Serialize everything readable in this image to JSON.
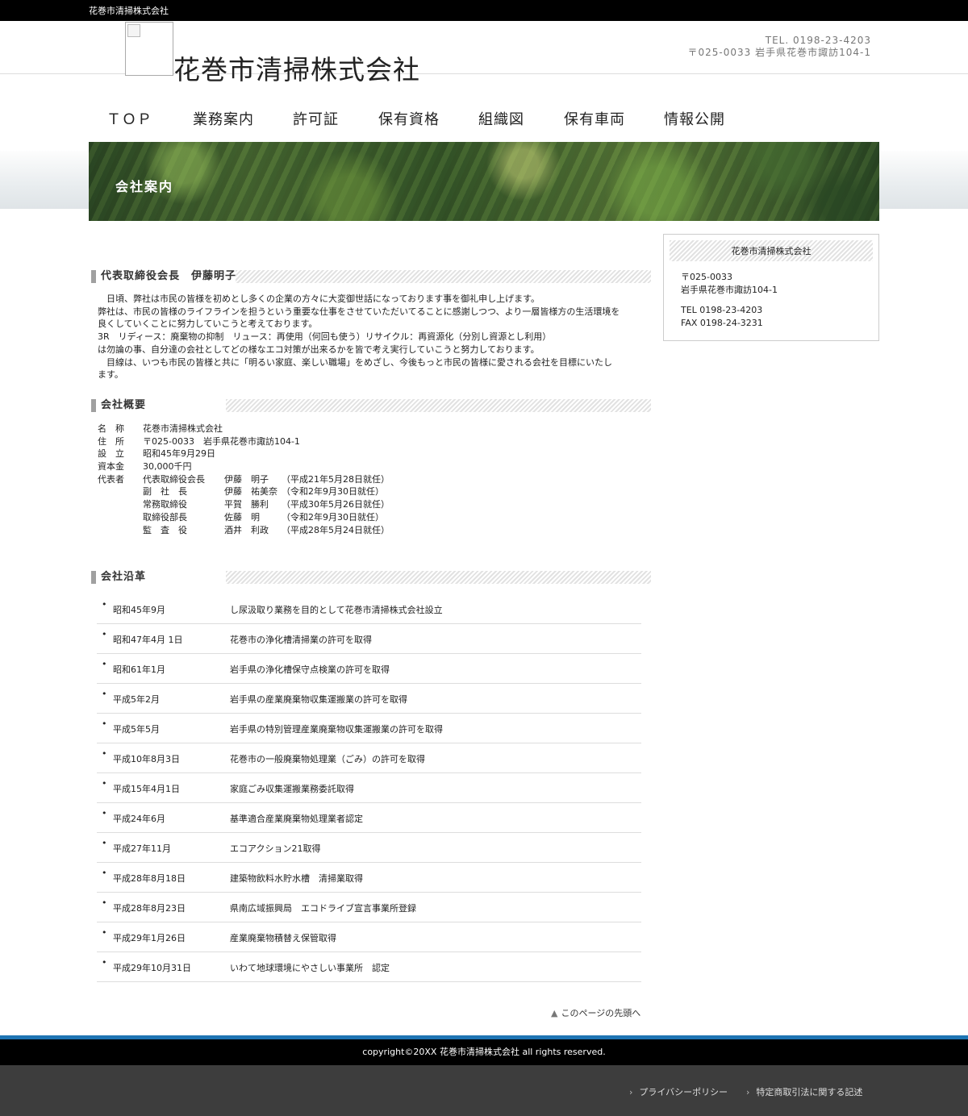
{
  "topbar": {
    "text": "花巻市清掃株式会社"
  },
  "header": {
    "site_name": "花巻市清掃株式会社",
    "tel": "TEL. 0198-23-4203",
    "address": "〒025-0033 岩手県花巻市諏訪104-1"
  },
  "nav": {
    "items": [
      {
        "label": "ＴＯＰ"
      },
      {
        "label": "業務案内"
      },
      {
        "label": "許可証"
      },
      {
        "label": "保有資格"
      },
      {
        "label": "組織図"
      },
      {
        "label": "保有車両"
      },
      {
        "label": "情報公開"
      }
    ]
  },
  "hero": {
    "title": "会社案内"
  },
  "greeting": {
    "heading": "代表取締役会長　伊藤明子",
    "lines": [
      "　日頃、弊社は市民の皆様を初めとし多くの企業の方々に大変御世話になっております事を御礼申し上げます。",
      "弊社は、市民の皆様のライフラインを担うという重要な仕事をさせていただいてることに感謝しつつ、より一層皆様方の生活環境を",
      "良くしていくことに努力していこうと考えております。",
      "3R　リディース：廃棄物の抑制　リュース：再使用（何回も使う）リサイクル：再資源化（分別し資源とし利用）",
      "は勿論の事、自分達の会社としてどの様なエコ対策が出来るかを皆で考え実行していこうと努力しております。",
      "　目線は、いつも市民の皆様と共に「明るい家庭、楽しい職場」をめざし、今後もっと市民の皆様に愛される会社を目標にいたし",
      "ます。"
    ]
  },
  "overview": {
    "heading": "会社概要",
    "rows": [
      {
        "label": "名　称",
        "value": "花巻市清掃株式会社"
      },
      {
        "label": "住　所",
        "value": "〒025-0033　岩手県花巻市諏訪104-1"
      },
      {
        "label": "設　立",
        "value": "昭和45年9月29日"
      },
      {
        "label": "資本金",
        "value": "30,000千円"
      }
    ],
    "rep_label": "代表者",
    "officers": [
      {
        "title": "代表取締役会長",
        "name": "伊藤　明子",
        "note": "（平成21年5月28日就任）"
      },
      {
        "title": "副　社　長",
        "name": "伊藤　祐美奈",
        "note": "（令和2年9月30日就任）"
      },
      {
        "title": "常務取締役",
        "name": "平賀　勝利",
        "note": "（平成30年5月26日就任）"
      },
      {
        "title": "取締役部長",
        "name": "佐藤　明",
        "note": "（令和2年9月30日就任）"
      },
      {
        "title": "監　査　役",
        "name": "酒井　利政",
        "note": "（平成28年5月24日就任）"
      }
    ]
  },
  "history": {
    "heading": "会社沿革",
    "items": [
      {
        "date": "昭和45年9月",
        "event": "し尿汲取り業務を目的として花巻市清掃株式会社設立"
      },
      {
        "date": "昭和47年4月 1日",
        "event": "花巻市の浄化槽清掃業の許可を取得"
      },
      {
        "date": "昭和61年1月",
        "event": "岩手県の浄化槽保守点検業の許可を取得"
      },
      {
        "date": "平成5年2月",
        "event": "岩手県の産業廃棄物収集運搬業の許可を取得"
      },
      {
        "date": "平成5年5月",
        "event": "岩手県の特別管理産業廃棄物収集運搬業の許可を取得"
      },
      {
        "date": "平成10年8月3日",
        "event": "花巻市の一般廃棄物処理業（ごみ）の許可を取得"
      },
      {
        "date": "平成15年4月1日",
        "event": "家庭ごみ収集運搬業務委託取得"
      },
      {
        "date": "平成24年6月",
        "event": "基準適合産業廃棄物処理業者認定"
      },
      {
        "date": "平成27年11月",
        "event": "エコアクション21取得"
      },
      {
        "date": "平成28年8月18日",
        "event": "建築物飲料水貯水槽　清掃業取得"
      },
      {
        "date": "平成28年8月23日",
        "event": "県南広域振興局　エコドライブ宣言事業所登録"
      },
      {
        "date": "平成29年1月26日",
        "event": "産業廃棄物積替え保管取得"
      },
      {
        "date": "平成29年10月31日",
        "event": "いわて地球環境にやさしい事業所　認定"
      }
    ]
  },
  "page_top": {
    "label": "このページの先頭へ"
  },
  "sidebar": {
    "title": "花巻市清掃株式会社",
    "postal": "〒025-0033",
    "address": "岩手県花巻市諏訪104-1",
    "tel": "TEL 0198-23-4203",
    "fax": "FAX 0198-24-3231"
  },
  "footer": {
    "copyright": "copyright©20XX 花巻市清掃株式会社 all rights reserved.",
    "links": [
      {
        "label": "プライバシーポリシー"
      },
      {
        "label": "特定商取引法に関する記述"
      }
    ]
  },
  "colors": {
    "accent_line": "#1e74b3",
    "footer_black": "#000000",
    "footer_gray": "#3d3d3d"
  }
}
